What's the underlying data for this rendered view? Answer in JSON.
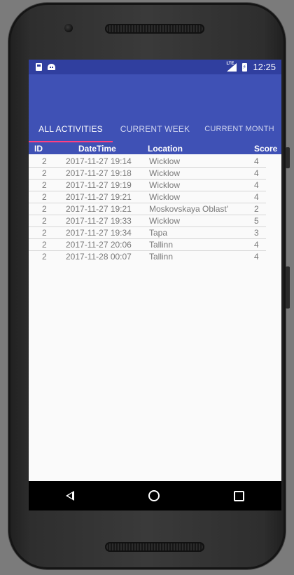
{
  "status_bar": {
    "left_icons": [
      "sd-card-icon",
      "android-icon"
    ],
    "right_icons": [
      "lte-signal-icon",
      "battery-charging-icon"
    ],
    "network_label": "LTE",
    "time": "12:25"
  },
  "tabs": [
    {
      "label": "ALL ACTIVITIES",
      "active": true
    },
    {
      "label": "CURRENT WEEK",
      "active": false
    },
    {
      "label": "CURRENT MONTH",
      "active": false
    }
  ],
  "table": {
    "columns": [
      "ID",
      "DateTime",
      "Location",
      "Score"
    ],
    "rows": [
      {
        "id": "2",
        "datetime": "2017-11-27 19:14",
        "location": "Wicklow",
        "score": "4"
      },
      {
        "id": "2",
        "datetime": "2017-11-27 19:18",
        "location": "Wicklow",
        "score": "4"
      },
      {
        "id": "2",
        "datetime": "2017-11-27 19:19",
        "location": "Wicklow",
        "score": "4"
      },
      {
        "id": "2",
        "datetime": "2017-11-27 19:21",
        "location": "Wicklow",
        "score": "4"
      },
      {
        "id": "2",
        "datetime": "2017-11-27 19:21",
        "location": "Moskovskaya Oblast'",
        "score": "2"
      },
      {
        "id": "2",
        "datetime": "2017-11-27 19:33",
        "location": "Wicklow",
        "score": "5"
      },
      {
        "id": "2",
        "datetime": "2017-11-27 19:34",
        "location": "Tapa",
        "score": "3"
      },
      {
        "id": "2",
        "datetime": "2017-11-27 20:06",
        "location": "Tallinn",
        "score": "4"
      },
      {
        "id": "2",
        "datetime": "2017-11-28 00:07",
        "location": "Tallinn",
        "score": "4"
      }
    ]
  },
  "nav_bar": {
    "icons": [
      "back-icon",
      "home-icon",
      "recents-icon"
    ]
  },
  "colors": {
    "primary": "#3f51b5",
    "primary_dark": "#303f9f",
    "accent": "#ff4081",
    "row_text": "#7a7a7a",
    "background": "#fafafa"
  }
}
